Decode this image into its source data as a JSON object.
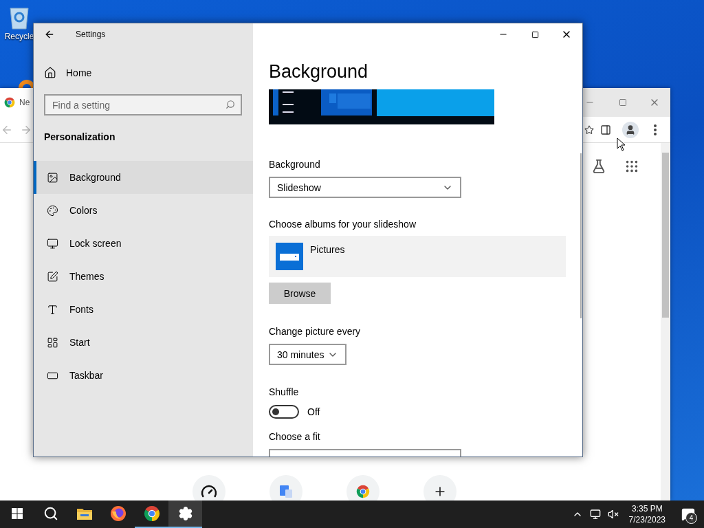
{
  "desktop": {
    "icons": [
      {
        "label": "Recycle"
      }
    ]
  },
  "browser": {
    "tab": {
      "title": "Ne"
    },
    "shortcuts": [
      {
        "kind": "gauge"
      },
      {
        "kind": "translate"
      },
      {
        "kind": "store"
      },
      {
        "kind": "add"
      }
    ]
  },
  "settings": {
    "title": "Settings",
    "home": "Home",
    "search": {
      "placeholder": "Find a setting"
    },
    "section": "Personalization",
    "nav": [
      {
        "label": "Background",
        "kind": "background",
        "selected": true
      },
      {
        "label": "Colors",
        "kind": "colors",
        "selected": false
      },
      {
        "label": "Lock screen",
        "kind": "lock",
        "selected": false
      },
      {
        "label": "Themes",
        "kind": "themes",
        "selected": false
      },
      {
        "label": "Fonts",
        "kind": "fonts",
        "selected": false
      },
      {
        "label": "Start",
        "kind": "start",
        "selected": false
      },
      {
        "label": "Taskbar",
        "kind": "taskbar",
        "selected": false
      }
    ],
    "page_title": "Background",
    "background": {
      "label": "Background",
      "value": "Slideshow"
    },
    "albums": {
      "label": "Choose albums for your slideshow",
      "items": [
        {
          "name": "Pictures"
        }
      ]
    },
    "browse": "Browse",
    "interval": {
      "label": "Change picture every",
      "value": "30 minutes"
    },
    "shuffle": {
      "label": "Shuffle",
      "on": false,
      "state_text": "Off"
    },
    "fit": {
      "label": "Choose a fit"
    }
  },
  "taskbar": {
    "apps": [
      {
        "kind": "start",
        "running": false,
        "selected": false
      },
      {
        "kind": "search",
        "running": false,
        "selected": false
      },
      {
        "kind": "explorer",
        "running": false,
        "selected": false
      },
      {
        "kind": "firefox",
        "running": false,
        "selected": false
      },
      {
        "kind": "chrome",
        "running": true,
        "selected": false
      },
      {
        "kind": "settings",
        "running": true,
        "selected": true
      }
    ],
    "time": "3:35 PM",
    "date": "7/23/2023",
    "notifications": "4"
  }
}
